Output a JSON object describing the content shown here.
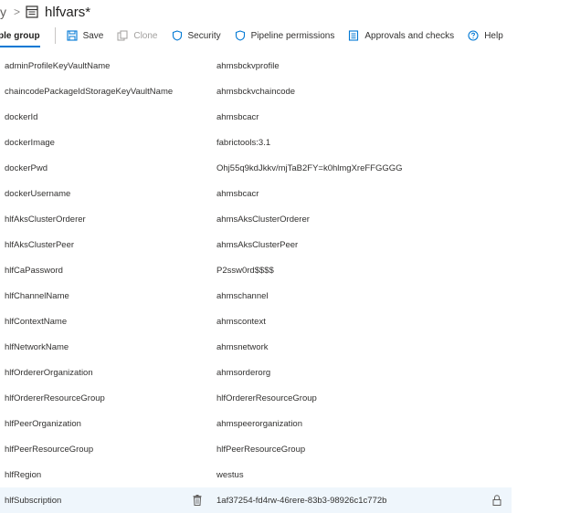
{
  "breadcrumb": {
    "previous": "y",
    "separator": ">",
    "title": "hlfvars*"
  },
  "toolbar": {
    "active_tab": "ple group",
    "save": "Save",
    "clone": "Clone",
    "security": "Security",
    "pipeline_permissions": "Pipeline permissions",
    "approvals": "Approvals and checks",
    "help": "Help"
  },
  "variables": [
    {
      "name": "adminProfileKeyVaultName",
      "value": "ahmsbckvprofile"
    },
    {
      "name": "chaincodePackageIdStorageKeyVaultName",
      "value": "ahmsbckvchaincode"
    },
    {
      "name": "dockerId",
      "value": "ahmsbcacr"
    },
    {
      "name": "dockerImage",
      "value": "fabrictools:3.1"
    },
    {
      "name": "dockerPwd",
      "value": "Ohj55q9kdJkkv/mjTaB2FY=k0hlmgXreFFGGGG"
    },
    {
      "name": "dockerUsername",
      "value": "ahmsbcacr"
    },
    {
      "name": "hlfAksClusterOrderer",
      "value": "ahmsAksClusterOrderer"
    },
    {
      "name": "hlfAksClusterPeer",
      "value": "ahmsAksClusterPeer"
    },
    {
      "name": "hlfCaPassword",
      "value": "P2ssw0rd$$$$"
    },
    {
      "name": "hlfChannelName",
      "value": "ahmschannel"
    },
    {
      "name": "hlfContextName",
      "value": "ahmscontext"
    },
    {
      "name": "hlfNetworkName",
      "value": "ahmsnetwork"
    },
    {
      "name": "hlfOrdererOrganization",
      "value": "ahmsorderorg"
    },
    {
      "name": "hlfOrdererResourceGroup",
      "value": "hlfOrdererResourceGroup"
    },
    {
      "name": "hlfPeerOrganization",
      "value": "ahmspeerorganization"
    },
    {
      "name": "hlfPeerResourceGroup",
      "value": "hlfPeerResourceGroup"
    },
    {
      "name": "hlfRegion",
      "value": "westus"
    },
    {
      "name": "hlfSubscription",
      "value": "1af37254-fd4rw-46rere-83b3-98926c1c772b",
      "selected": true
    }
  ],
  "colors": {
    "accent": "#0078d4",
    "selected_row": "#eff6fc"
  }
}
